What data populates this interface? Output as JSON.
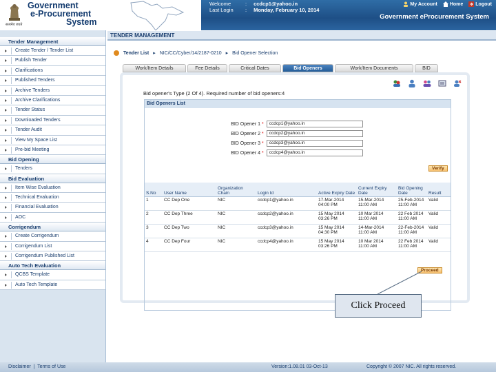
{
  "header": {
    "org_line1": "Government",
    "org_line2": "e-Procurement",
    "org_line3": "System",
    "emblem_caption": "सत्यमेव जयते",
    "welcome_label": "Welcome",
    "welcome_value": "ccdcp1@yahoo.in",
    "last_login_label": "Last Login",
    "last_login_value": "Monday, February 10, 2014",
    "colon": ":",
    "my_account": "My Account",
    "home": "Home",
    "logout": "Logout",
    "system_name": "Government eProcurement System"
  },
  "sidebar": {
    "sections": [
      {
        "title": "Tender Management",
        "items": [
          "Create Tender / Tender List",
          "Publish Tender",
          "Clarifications",
          "Published Tenders",
          "Archive Tenders",
          "Archive Clarifications",
          "Tender Status",
          "Downloaded Tenders",
          "Tender Audit",
          "View My Space List",
          "Pre-bid Meeting"
        ]
      },
      {
        "title": "Bid Opening",
        "items": [
          "Tenders"
        ]
      },
      {
        "title": "Bid Evaluation",
        "items": [
          "Item Wise Evaluation",
          "Technical Evaluation",
          "Financial Evaluation",
          "AOC"
        ]
      },
      {
        "title": "Corrigendum",
        "items": [
          "Create Corrigendum",
          "Corrigendum List",
          "Corrigendum Published List"
        ]
      },
      {
        "title": "Auto Tech Evaluation",
        "items": [
          "QCBS Template",
          "Auto Tech Template"
        ]
      }
    ]
  },
  "main": {
    "title": "TENDER MANAGEMENT",
    "breadcrumb": {
      "home": "Tender List",
      "sep": "▸",
      "tender_id": "NIC/CC/Cyber/14/2187-0210",
      "current": "Bid Opener Selection"
    },
    "tabs": [
      "Work/Item Details",
      "Fee Details",
      "Critical Dates",
      "Bid Openers",
      "Work/Item Documents",
      "BID"
    ],
    "active_tab_index": 3,
    "type_line": "Bid opener's Type (2 Of 4). Required number of bid openers:4",
    "bol_title": "Bid Openers List",
    "openers": [
      {
        "label": "BID Opener 1",
        "value": "ccdcp1@yahoo.in"
      },
      {
        "label": "BID Opener 2",
        "value": "ccdcp2@yahoo.in"
      },
      {
        "label": "BID Opener 3",
        "value": "ccdcp3@yahoo.in"
      },
      {
        "label": "BID Opener 4",
        "value": "ccdcp4@yahoo.in"
      }
    ],
    "required_mark": "*",
    "verify_label": "Verify",
    "proceed_label": "Proceed",
    "table": {
      "headers": [
        "S.No",
        "User Name",
        "Organization Chain",
        "Login Id",
        "Active Expiry Date",
        "Current Expiry Date",
        "Bid Opening Date",
        "Result"
      ],
      "rows": [
        [
          "1",
          "CC Dep One",
          "NIC",
          "ccdcp1@yahoo.in",
          "17-Mar-2014 04:00 PM",
          "15-Mar-2014 11:00 AM",
          "25-Feb-2014 11:00 AM",
          "Valid"
        ],
        [
          "2",
          "CC Dep Three",
          "NIC",
          "ccdcp2@yahoo.in",
          "15 May 2014 03:26 PM",
          "10 Mar 2014 11:00 AM",
          "22 Feb 2014 11:00 AM",
          "Valid"
        ],
        [
          "3",
          "CC Dep Two",
          "NIC",
          "ccdcp3@yahoo.in",
          "15 May 2014 04:30 PM",
          "14-Mar-2014 11:00 AM",
          "22-Feb-2014 11:00 AM",
          "Valid"
        ],
        [
          "4",
          "CC Dep Four",
          "NIC",
          "ccdcp4@yahoo.in",
          "15 May 2014 03:26 PM",
          "10 Mar 2014 11:00 AM",
          "22 Feb 2014 11:00 AM",
          "Valid"
        ]
      ]
    },
    "callout": "Click Proceed"
  },
  "footer": {
    "disclaimer": "Disclaimer",
    "sep": "|",
    "terms": "Terms of Use",
    "version": "Version:1.08.01 03-Oct-13",
    "copyright": "Copyright © 2007 NIC. All rights reserved."
  },
  "colors": {
    "accent": "#1e4f86",
    "button": "#f6c070",
    "sidebar": "#d9e4ef"
  }
}
